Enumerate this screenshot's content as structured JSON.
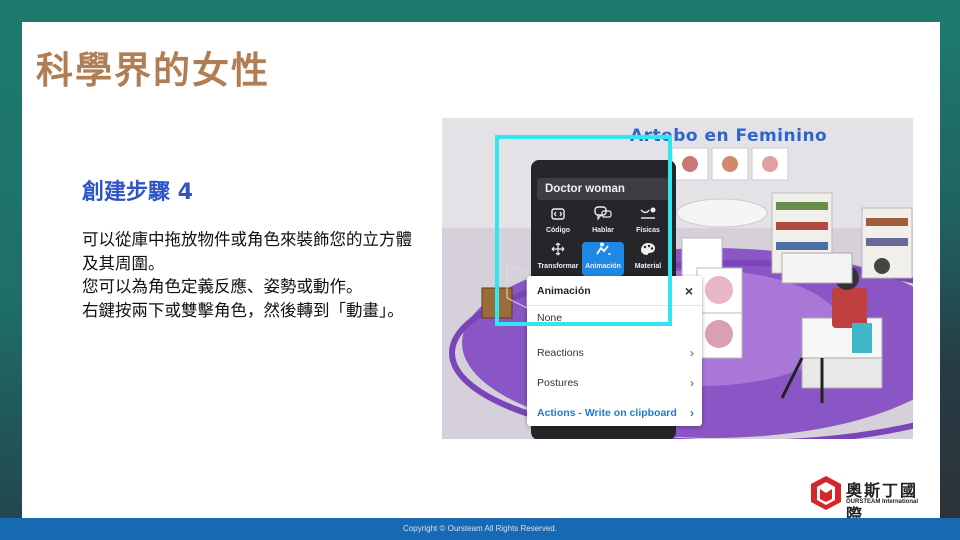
{
  "slide": {
    "title": "科學界的女性",
    "step_heading": "創建步驟 4",
    "body_lines": [
      "可以從庫中拖放物件或角色來裝飾您的立方體及其周圍。",
      "您可以為角色定義反應、姿勢或動作。",
      "右鍵按兩下或雙擊角色，然後轉到「動畫」。"
    ]
  },
  "screenshot": {
    "banner": "Artebo en Feminino",
    "panel_title": "Doctor woman",
    "tools": [
      {
        "label": "Código",
        "icon": "code-icon"
      },
      {
        "label": "Hablar",
        "icon": "speech-icon"
      },
      {
        "label": "Físicas",
        "icon": "physics-icon"
      },
      {
        "label": "Transformar",
        "icon": "move-icon"
      },
      {
        "label": "Animación",
        "icon": "animation-icon",
        "active": true
      },
      {
        "label": "Material",
        "icon": "palette-icon"
      }
    ],
    "menu": {
      "header": "Animación",
      "none": "None",
      "items": [
        "Reactions",
        "Postures"
      ],
      "actions": "Actions - Write on clipboard"
    }
  },
  "footer": {
    "copyright": "Copyright © Oursteam All Rights Reserved."
  },
  "logo": {
    "chinese": "奧斯丁國際",
    "english": "OURSTEAM International"
  },
  "colors": {
    "title": "#b07e52",
    "heading": "#2e55c8",
    "highlight": "#33e6ee",
    "footer": "#1769b3",
    "active_tool": "#1e88e5"
  }
}
